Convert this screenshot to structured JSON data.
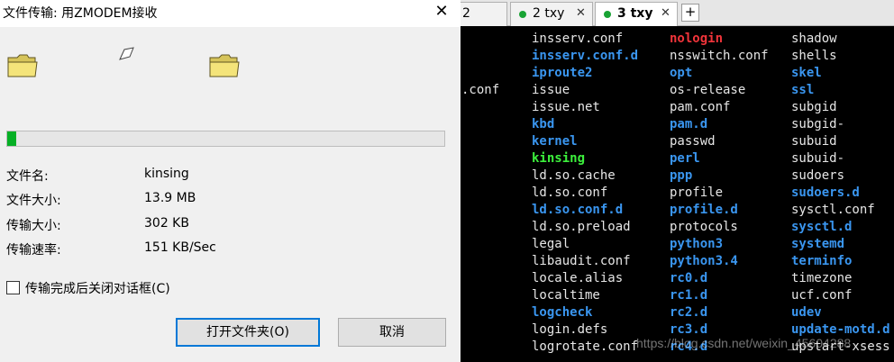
{
  "dialog": {
    "title": "文件传输: 用ZMODEM接收",
    "close_glyph": "✕",
    "progress": 0.02,
    "info": [
      {
        "label": "文件名:",
        "value": "kinsing"
      },
      {
        "label": "文件大小:",
        "value": "13.9 MB"
      },
      {
        "label": "传输大小:",
        "value": "302 KB"
      },
      {
        "label": "传输速率:",
        "value": "151 KB/Sec"
      }
    ],
    "close_after_label": "传输完成后关闭对话框(C)",
    "open_folder_label": "打开文件夹(O)",
    "cancel_label": "取消"
  },
  "terminal": {
    "tabs": [
      {
        "label": "2"
      },
      {
        "label": "2 txy",
        "close": "✕"
      },
      {
        "label": "3 txy",
        "close": "✕"
      }
    ],
    "add_tab": "+",
    "colors": {
      "plain": "#e6e6e6",
      "dir": "#3a96f0",
      "red": "#f0343a",
      "green": "#3cf03c"
    },
    "col0": [
      {
        "text": ".conf",
        "row": 3,
        "style": "plain"
      }
    ],
    "col1": [
      {
        "text": "insserv.conf",
        "style": "plain"
      },
      {
        "text": "insserv.conf.d",
        "style": "dir"
      },
      {
        "text": "iproute2",
        "style": "dir"
      },
      {
        "text": "issue",
        "style": "plain"
      },
      {
        "text": "issue.net",
        "style": "plain"
      },
      {
        "text": "kbd",
        "style": "dir"
      },
      {
        "text": "kernel",
        "style": "dir"
      },
      {
        "text": "kinsing",
        "style": "green"
      },
      {
        "text": "ld.so.cache",
        "style": "plain"
      },
      {
        "text": "ld.so.conf",
        "style": "plain"
      },
      {
        "text": "ld.so.conf.d",
        "style": "dir"
      },
      {
        "text": "ld.so.preload",
        "style": "plain"
      },
      {
        "text": "legal",
        "style": "plain"
      },
      {
        "text": "libaudit.conf",
        "style": "plain"
      },
      {
        "text": "locale.alias",
        "style": "plain"
      },
      {
        "text": "localtime",
        "style": "plain"
      },
      {
        "text": "logcheck",
        "style": "dir"
      },
      {
        "text": "login.defs",
        "style": "plain"
      },
      {
        "text": "logrotate.conf",
        "style": "plain"
      }
    ],
    "col2": [
      {
        "text": "nologin",
        "style": "red"
      },
      {
        "text": "nsswitch.conf",
        "style": "plain"
      },
      {
        "text": "opt",
        "style": "dir"
      },
      {
        "text": "os-release",
        "style": "plain"
      },
      {
        "text": "pam.conf",
        "style": "plain"
      },
      {
        "text": "pam.d",
        "style": "dir"
      },
      {
        "text": "passwd",
        "style": "plain"
      },
      {
        "text": "perl",
        "style": "dir"
      },
      {
        "text": "ppp",
        "style": "dir"
      },
      {
        "text": "profile",
        "style": "plain"
      },
      {
        "text": "profile.d",
        "style": "dir"
      },
      {
        "text": "protocols",
        "style": "plain"
      },
      {
        "text": "python3",
        "style": "dir"
      },
      {
        "text": "python3.4",
        "style": "dir"
      },
      {
        "text": "rc0.d",
        "style": "dir"
      },
      {
        "text": "rc1.d",
        "style": "dir"
      },
      {
        "text": "rc2.d",
        "style": "dir"
      },
      {
        "text": "rc3.d",
        "style": "dir"
      },
      {
        "text": "rc4.d",
        "style": "dir"
      }
    ],
    "col3": [
      {
        "text": "shadow",
        "style": "plain"
      },
      {
        "text": "shells",
        "style": "plain"
      },
      {
        "text": "skel",
        "style": "dir"
      },
      {
        "text": "ssl",
        "style": "dir"
      },
      {
        "text": "subgid",
        "style": "plain"
      },
      {
        "text": "subgid-",
        "style": "plain"
      },
      {
        "text": "subuid",
        "style": "plain"
      },
      {
        "text": "subuid-",
        "style": "plain"
      },
      {
        "text": "sudoers",
        "style": "plain"
      },
      {
        "text": "sudoers.d",
        "style": "dir"
      },
      {
        "text": "sysctl.conf",
        "style": "plain"
      },
      {
        "text": "sysctl.d",
        "style": "dir"
      },
      {
        "text": "systemd",
        "style": "dir"
      },
      {
        "text": "terminfo",
        "style": "dir"
      },
      {
        "text": "timezone",
        "style": "plain"
      },
      {
        "text": "ucf.conf",
        "style": "plain"
      },
      {
        "text": "udev",
        "style": "dir"
      },
      {
        "text": "update-motd.d",
        "style": "dir"
      },
      {
        "text": "upstart-xsess",
        "style": "plain"
      }
    ],
    "watermark": "https://blog.csdn.net/weixin_45604288"
  }
}
